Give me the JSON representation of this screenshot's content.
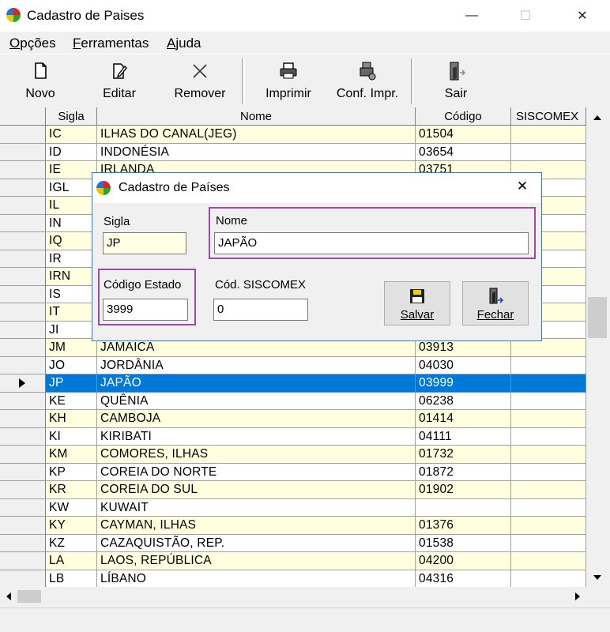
{
  "window": {
    "title": "Cadastro de Paises",
    "minimize_glyph": "—",
    "maximize_glyph": "☐",
    "close_glyph": "✕"
  },
  "menu": [
    {
      "label": "Opções",
      "mnemonic": "O"
    },
    {
      "label": "Ferramentas",
      "mnemonic": "F"
    },
    {
      "label": "Ajuda",
      "mnemonic": "A"
    }
  ],
  "toolbar": {
    "novo": "Novo",
    "editar": "Editar",
    "remover": "Remover",
    "imprimir": "Imprimir",
    "conf_impr": "Conf. Impr.",
    "sair": "Sair"
  },
  "grid": {
    "columns": [
      "Sigla",
      "Nome",
      "Código",
      "SISCOMEX"
    ],
    "selected_index": 14,
    "rows": [
      {
        "sigla": "IC",
        "nome": "ILHAS DO CANAL(JEG)",
        "codigo": "01504",
        "siscomex": ""
      },
      {
        "sigla": "ID",
        "nome": "INDONÉSIA",
        "codigo": "03654",
        "siscomex": ""
      },
      {
        "sigla": "IE",
        "nome": "IRLANDA",
        "codigo": "03751",
        "siscomex": ""
      },
      {
        "sigla": "IGL",
        "nome": "",
        "codigo": "",
        "siscomex": ""
      },
      {
        "sigla": "IL",
        "nome": "",
        "codigo": "",
        "siscomex": ""
      },
      {
        "sigla": "IN",
        "nome": "",
        "codigo": "",
        "siscomex": ""
      },
      {
        "sigla": "IQ",
        "nome": "",
        "codigo": "",
        "siscomex": ""
      },
      {
        "sigla": "IR",
        "nome": "",
        "codigo": "",
        "siscomex": ""
      },
      {
        "sigla": "IRN",
        "nome": "",
        "codigo": "",
        "siscomex": ""
      },
      {
        "sigla": "IS",
        "nome": "",
        "codigo": "",
        "siscomex": ""
      },
      {
        "sigla": "IT",
        "nome": "",
        "codigo": "",
        "siscomex": ""
      },
      {
        "sigla": "JI",
        "nome": "",
        "codigo": "",
        "siscomex": ""
      },
      {
        "sigla": "JM",
        "nome": "JAMAICA",
        "codigo": "03913",
        "siscomex": ""
      },
      {
        "sigla": "JO",
        "nome": "JORDÂNIA",
        "codigo": "04030",
        "siscomex": ""
      },
      {
        "sigla": "JP",
        "nome": "JAPÃO",
        "codigo": "03999",
        "siscomex": ""
      },
      {
        "sigla": "KE",
        "nome": "QUÊNIA",
        "codigo": "06238",
        "siscomex": ""
      },
      {
        "sigla": "KH",
        "nome": "CAMBOJA",
        "codigo": "01414",
        "siscomex": ""
      },
      {
        "sigla": "KI",
        "nome": "KIRIBATI",
        "codigo": "04111",
        "siscomex": ""
      },
      {
        "sigla": "KM",
        "nome": "COMORES, ILHAS",
        "codigo": "01732",
        "siscomex": ""
      },
      {
        "sigla": "KP",
        "nome": "COREIA DO NORTE",
        "codigo": "01872",
        "siscomex": ""
      },
      {
        "sigla": "KR",
        "nome": "COREIA DO SUL",
        "codigo": "01902",
        "siscomex": ""
      },
      {
        "sigla": "KW",
        "nome": "KUWAIT",
        "codigo": "",
        "siscomex": ""
      },
      {
        "sigla": "KY",
        "nome": "CAYMAN, ILHAS",
        "codigo": "01376",
        "siscomex": ""
      },
      {
        "sigla": "KZ",
        "nome": "CAZAQUISTÃO, REP.",
        "codigo": "01538",
        "siscomex": ""
      },
      {
        "sigla": "LA",
        "nome": "LAOS, REPÚBLICA",
        "codigo": "04200",
        "siscomex": ""
      },
      {
        "sigla": "LB",
        "nome": "LÍBANO",
        "codigo": "04316",
        "siscomex": ""
      }
    ]
  },
  "dialog": {
    "title": "Cadastro de Países",
    "close_glyph": "✕",
    "sigla_label": "Sigla",
    "sigla_value": "JP",
    "nome_label": "Nome",
    "nome_value": "JAPÃO",
    "codigo_estado_label": "Código Estado",
    "codigo_estado_value": "3999",
    "cod_siscomex_label": "Cód. SISCOMEX",
    "cod_siscomex_value": "0",
    "salvar": "Salvar",
    "fechar": "Fechar"
  },
  "colors": {
    "selection": "#0078d7",
    "row_alt": "#ffffe0",
    "highlight_box": "#9b4aa8"
  }
}
